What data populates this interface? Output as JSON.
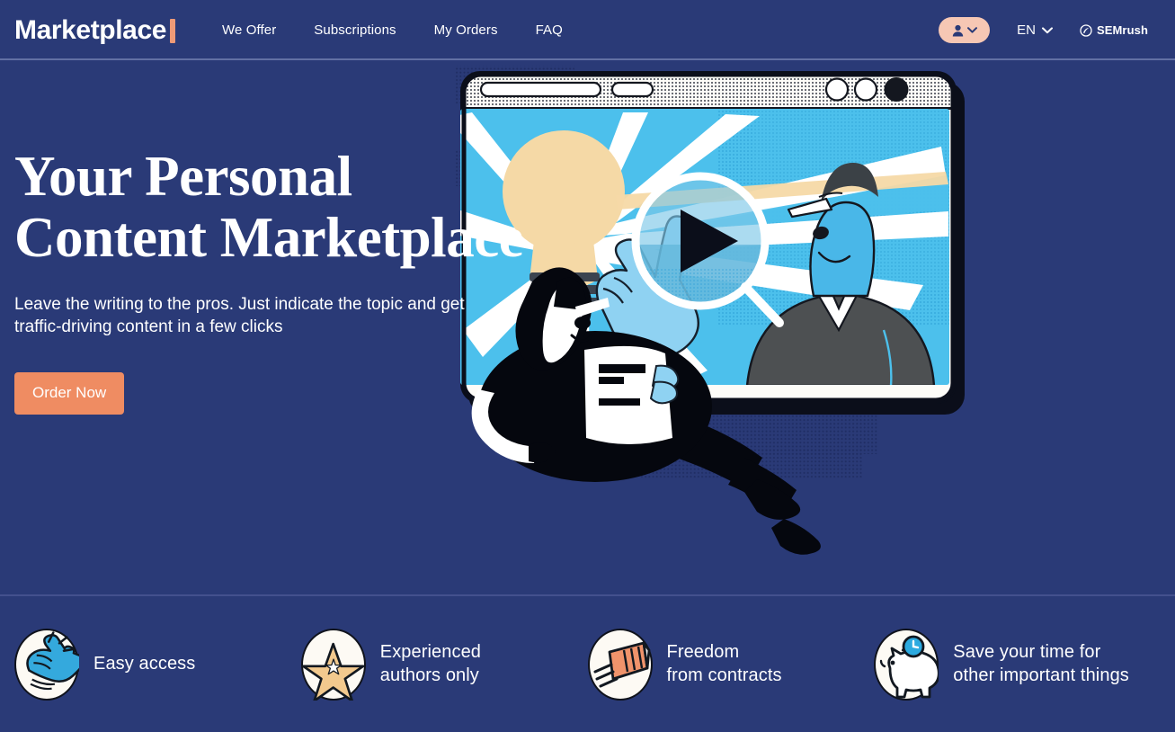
{
  "header": {
    "logo_text": "Marketplace",
    "logo_accent_color": "#ee9a77",
    "nav": [
      {
        "label": "We Offer",
        "name": "nav-we-offer"
      },
      {
        "label": "Subscriptions",
        "name": "nav-subscriptions"
      },
      {
        "label": "My Orders",
        "name": "nav-my-orders"
      },
      {
        "label": "FAQ",
        "name": "nav-faq"
      }
    ],
    "account": {
      "icon": "user-icon",
      "chevron": "chevron-down-icon",
      "bg_color": "#f6c7b4"
    },
    "language": {
      "value": "EN",
      "chevron": "chevron-down-icon"
    },
    "brand": {
      "label": "SEMrush",
      "icon": "semrush-logo-icon"
    },
    "background_color": "#2a3a77"
  },
  "hero": {
    "title_line1": "Your Personal",
    "title_line2": "Content Marketplace",
    "subtitle": "Leave the writing to the pros. Just indicate the topic and get traffic-driving content in a few clicks",
    "cta_label": "Order Now",
    "cta_color": "#ef8c62",
    "illustration": {
      "name": "hero-illustration",
      "description": "Person reclining reading a document next to a browser window showing a video with a character, lightbulb and play button",
      "browser_dots": [
        "white",
        "white",
        "black"
      ],
      "play_button": "play-icon",
      "screen_bg_color": "#4cc0ec"
    }
  },
  "features": [
    {
      "icon": "pointing-hand-icon",
      "line1": "Easy access",
      "line2": ""
    },
    {
      "icon": "star-icon",
      "line1": "Experienced",
      "line2": "authors only"
    },
    {
      "icon": "flying-contract-icon",
      "line1": "Freedom",
      "line2": "from contracts"
    },
    {
      "icon": "piggy-bank-clock-icon",
      "line1": "Save your time for",
      "line2": "other important things"
    }
  ]
}
